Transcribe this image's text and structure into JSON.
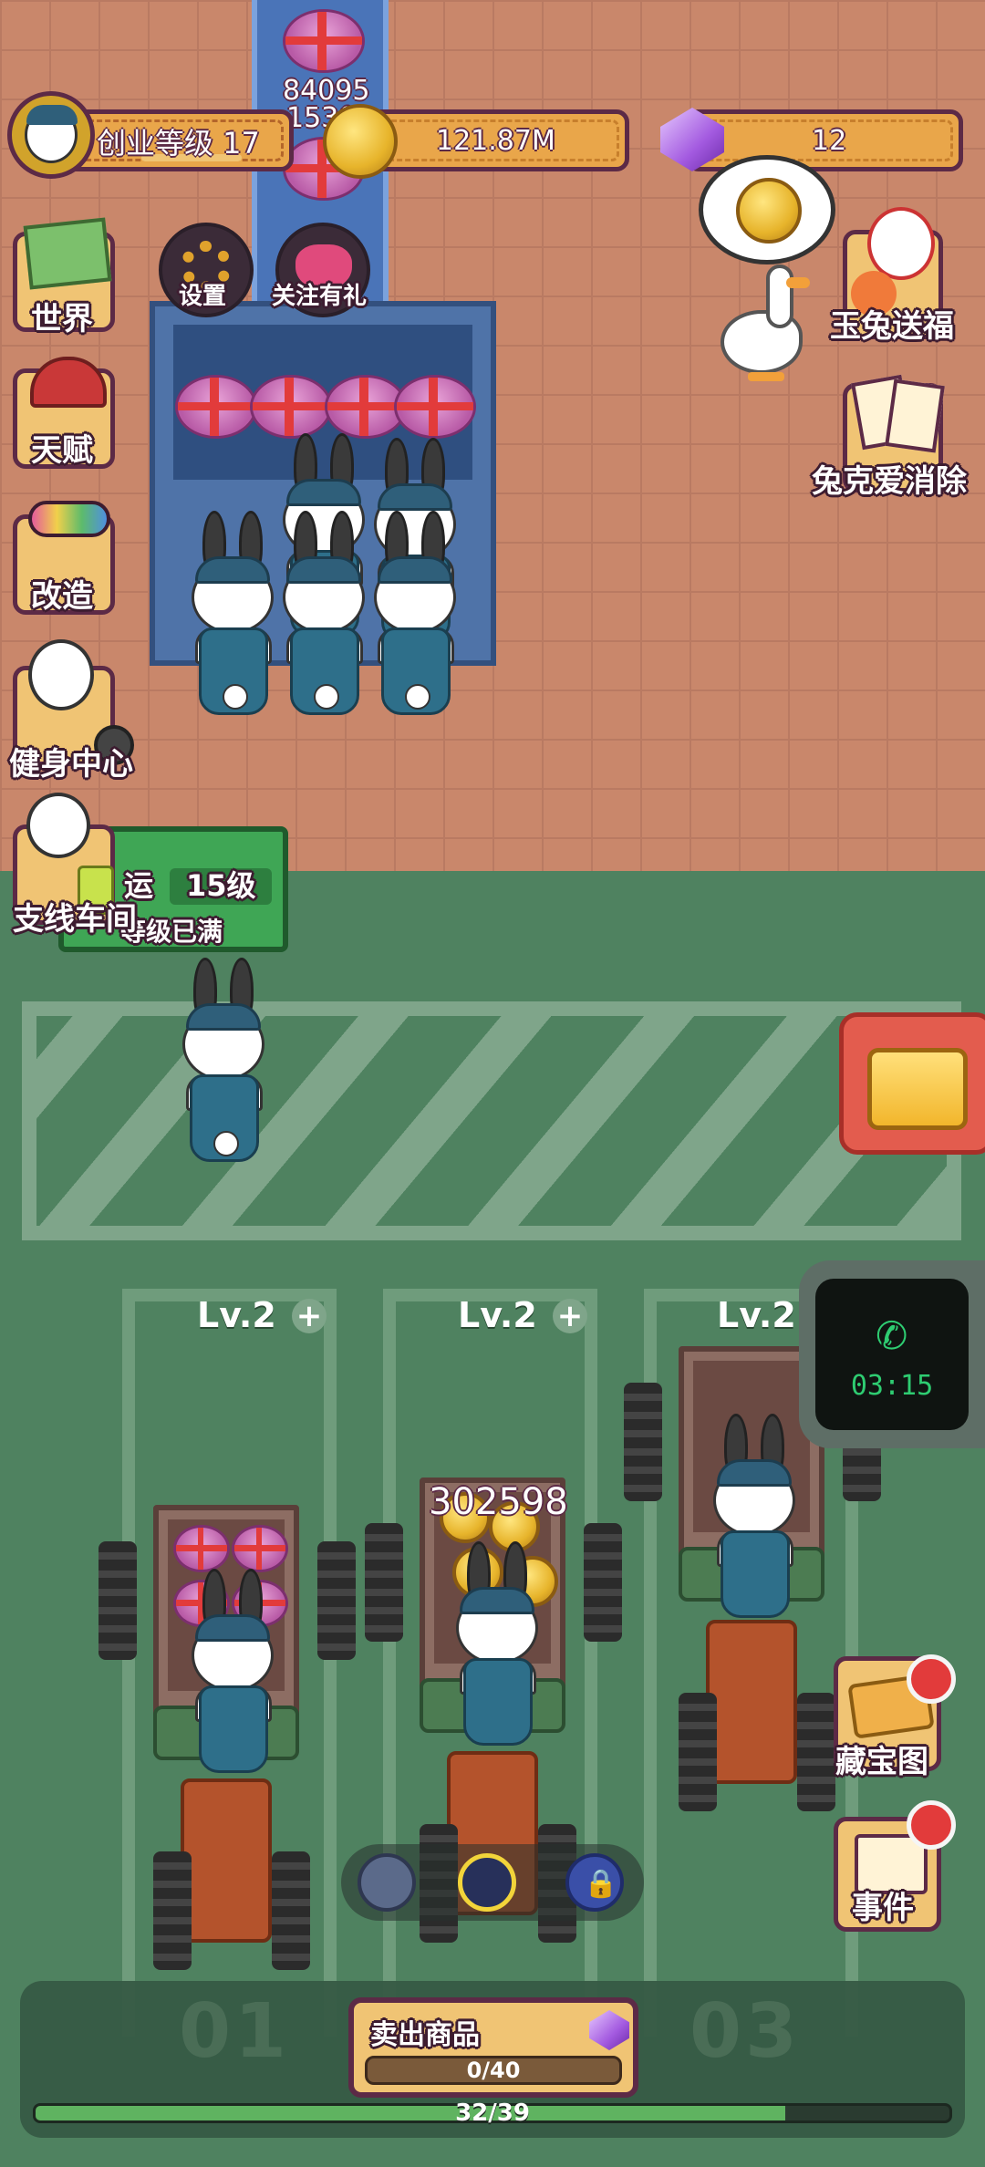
{
  "hud": {
    "level_label": "创业等级 17",
    "coins": "121.87M",
    "gems": "12",
    "floating_number_1": "84095",
    "floating_number_2": "1530"
  },
  "top_buttons": {
    "settings": "设置",
    "follow_gift": "关注有礼"
  },
  "left_menu": [
    {
      "label": "世界",
      "icon": "map-icon"
    },
    {
      "label": "天赋",
      "icon": "talent-icon"
    },
    {
      "label": "改造",
      "icon": "paint-roller-icon"
    },
    {
      "label": "健身中心",
      "icon": "gym-icon"
    },
    {
      "label": "支线车间",
      "icon": "workshop-icon"
    }
  ],
  "right_menu": [
    {
      "label": "玉兔送福",
      "icon": "jade-rabbit-icon"
    },
    {
      "label": "兔克爱消除",
      "icon": "cards-icon"
    },
    {
      "label": "藏宝图",
      "icon": "treasure-map-icon"
    },
    {
      "label": "事件",
      "icon": "event-book-icon"
    }
  ],
  "transport_sign": {
    "title": "运",
    "level": "15级",
    "status": "等级已满"
  },
  "lanes": [
    {
      "label": "Lv.2",
      "number": "01"
    },
    {
      "label": "Lv.2",
      "amount": "302598"
    },
    {
      "label": "Lv.2",
      "number": "03"
    }
  ],
  "phone_timer": "03:15",
  "sell": {
    "label": "卖出商品",
    "progress_text": "0/40"
  },
  "progress": {
    "text": "32/39",
    "value": 0.82
  },
  "colors": {
    "accent_orange": "#e9a64a",
    "border_purple": "#5c2a46",
    "floor_green": "#4f8260",
    "floor_brick": "#c9876b",
    "progress_green": "#5fb360",
    "phone_green": "#2ecc71"
  }
}
